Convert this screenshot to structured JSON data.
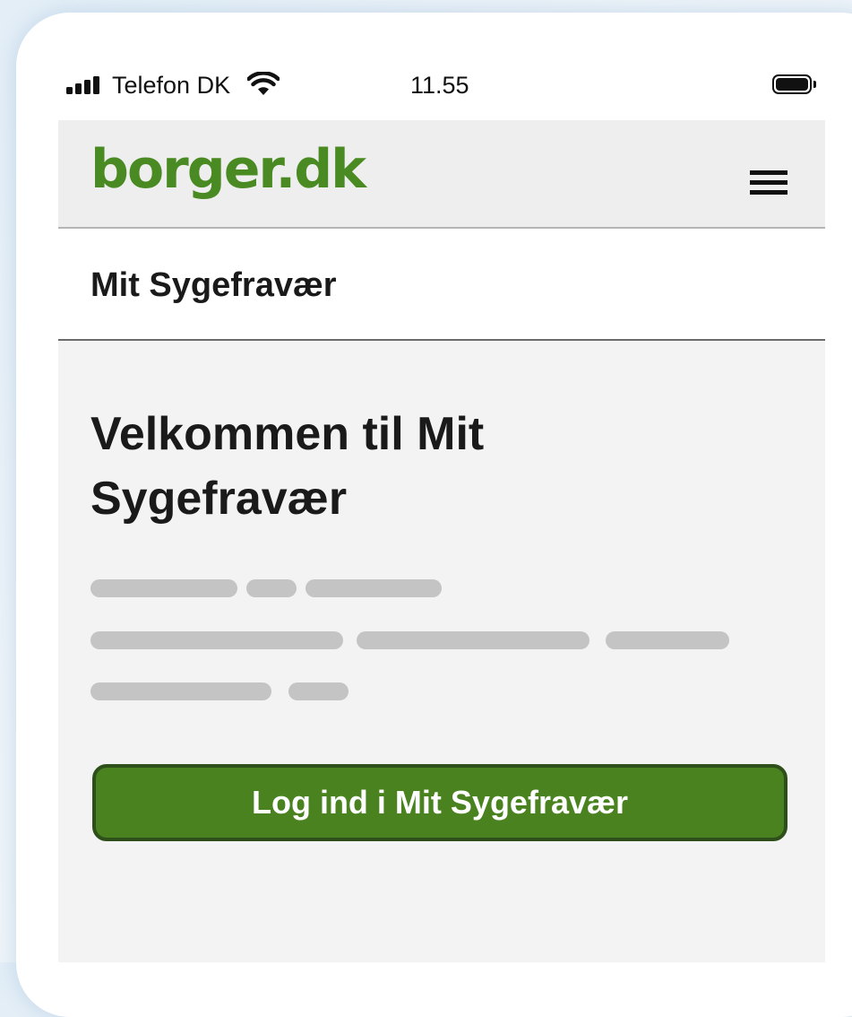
{
  "status_bar": {
    "carrier": "Telefon DK",
    "time": "11.55",
    "signal_icon": "signal-bars-icon",
    "wifi_icon": "wifi-icon",
    "battery_icon": "battery-icon",
    "battery_level": 1.0
  },
  "header": {
    "logo_text": "borger.dk",
    "menu_icon": "hamburger-menu-icon"
  },
  "section": {
    "title": "Mit Sygefravær"
  },
  "main": {
    "heading": "Velkommen til Mit Sygefravær",
    "login_button_label": "Log ind i Mit Sygefravær"
  },
  "colors": {
    "brand_green": "#4a8a22",
    "button_green": "#49821f",
    "button_border": "#2e4f1a",
    "content_background": "#f3f3f3",
    "header_background": "#eeeeee",
    "placeholder_gray": "#c4c4c4"
  }
}
